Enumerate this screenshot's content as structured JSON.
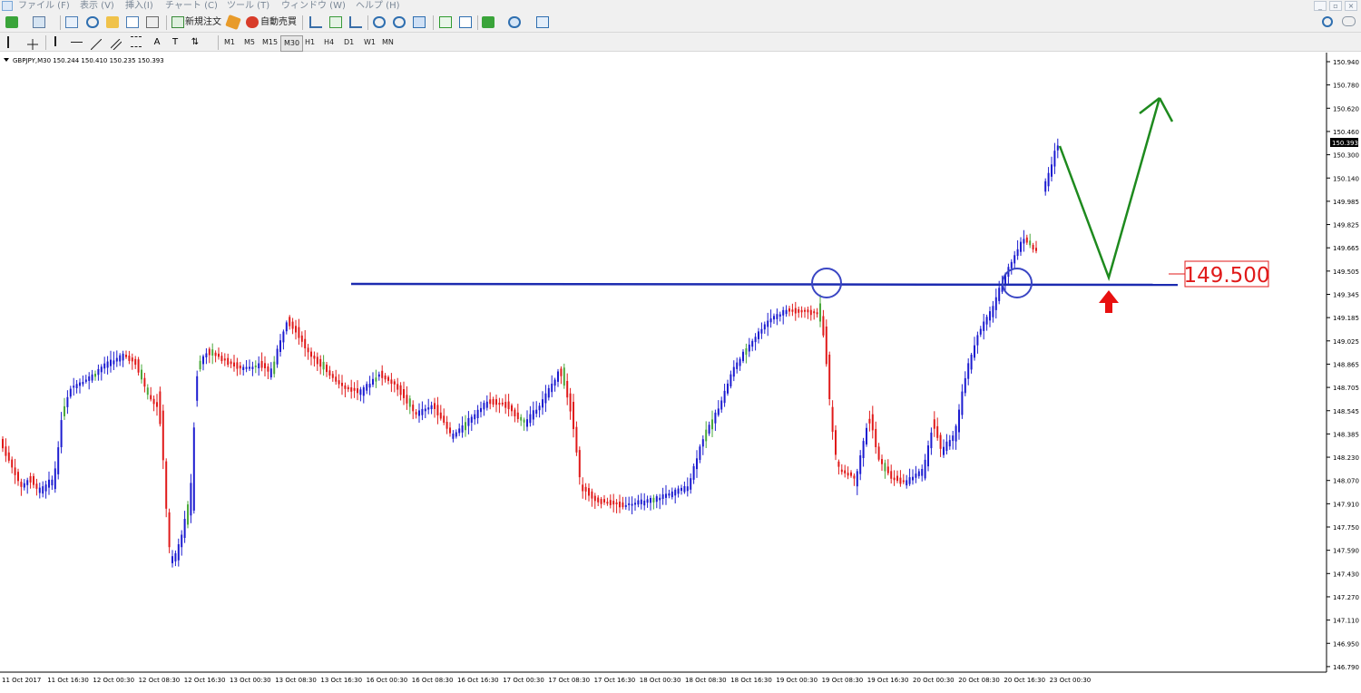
{
  "menu": {
    "items": [
      "ファイル (F)",
      "表示 (V)",
      "挿入(I)",
      "チャート (C)",
      "ツール (T)",
      "ウィンドウ (W)",
      "ヘルプ (H)"
    ]
  },
  "toolbar": {
    "new_order_label": "新規注文",
    "auto_trade_label": "自動売買",
    "timeframes": [
      "M1",
      "M5",
      "M15",
      "M30",
      "H1",
      "H4",
      "D1",
      "W1",
      "MN"
    ],
    "active_timeframe": "M30"
  },
  "chart": {
    "header": "GBPJPY,M30  150.244 150.410 150.235 150.393",
    "current_price": "150.393",
    "annotation_price": "149.500",
    "price_ticks": [
      "150.940",
      "150.780",
      "150.620",
      "150.460",
      "150.300",
      "150.140",
      "149.985",
      "149.825",
      "149.665",
      "149.505",
      "149.345",
      "149.185",
      "149.025",
      "148.865",
      "148.705",
      "148.545",
      "148.385",
      "148.230",
      "148.070",
      "147.910",
      "147.750",
      "147.590",
      "147.430",
      "147.270",
      "147.110",
      "146.950",
      "146.790"
    ],
    "time_ticks": [
      "11 Oct 2017",
      "11 Oct 16:30",
      "12 Oct 00:30",
      "12 Oct 08:30",
      "12 Oct 16:30",
      "13 Oct 00:30",
      "13 Oct 08:30",
      "13 Oct 16:30",
      "16 Oct 00:30",
      "16 Oct 08:30",
      "16 Oct 16:30",
      "17 Oct 00:30",
      "17 Oct 08:30",
      "17 Oct 16:30",
      "18 Oct 00:30",
      "18 Oct 08:30",
      "18 Oct 16:30",
      "19 Oct 00:30",
      "19 Oct 08:30",
      "19 Oct 16:30",
      "20 Oct 00:30",
      "20 Oct 08:30",
      "20 Oct 16:30",
      "23 Oct 00:30"
    ],
    "colors": {
      "bull": "#1c1cd0",
      "bear": "#e01a1a",
      "doji": "#4aa83a",
      "level": "#1c2bb0",
      "arrow_green": "#1e8a1e",
      "arrow_red": "#e81010",
      "label_red": "#e01a1a"
    }
  }
}
